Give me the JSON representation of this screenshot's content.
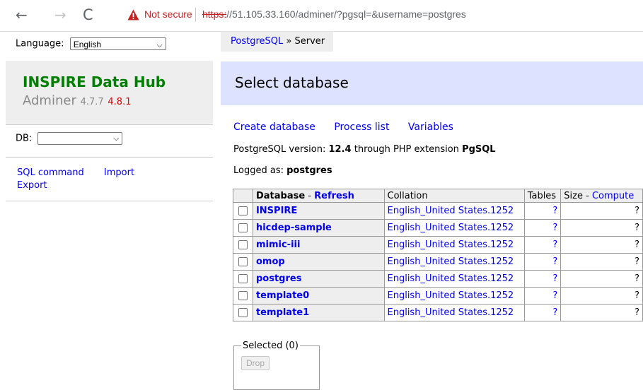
{
  "browser": {
    "back_glyph": "←",
    "forward_glyph": "→",
    "reload_glyph": "C",
    "security_label": "Not secure",
    "url_scheme": "https:",
    "url_rest": "//51.105.33.160/adminer/?pgsql=&username=postgres",
    "warning_color": "#c5221f"
  },
  "sidebar": {
    "language_label": "Language:",
    "language_value": "English",
    "brand_title": "INSPIRE Data Hub",
    "app_name": "Adminer",
    "version": "4.7.7",
    "new_version": "4.8.1",
    "db_label": "DB:",
    "db_value": "",
    "links": {
      "sql_command": "SQL command",
      "import": "Import",
      "export": "Export"
    }
  },
  "breadcrumb": {
    "driver": "PostgreSQL",
    "separator": "»",
    "current": "Server"
  },
  "main": {
    "title": "Select database",
    "actions": {
      "create_database": "Create database",
      "process_list": "Process list",
      "variables": "Variables"
    },
    "version_prefix": "PostgreSQL version:",
    "version_value": "12.4",
    "version_mid": "through PHP extension",
    "extension": "PgSQL",
    "logged_prefix": "Logged as:",
    "logged_user": "postgres"
  },
  "table": {
    "headers": {
      "database": "Database",
      "dash": "-",
      "refresh": "Refresh",
      "collation": "Collation",
      "tables": "Tables",
      "size": "Size",
      "compute": "Compute"
    },
    "rows": [
      {
        "name": "INSPIRE",
        "collation": "English_United States.1252",
        "tables": "?",
        "size": "?"
      },
      {
        "name": "hicdep-sample",
        "collation": "English_United States.1252",
        "tables": "?",
        "size": "?"
      },
      {
        "name": "mimic-iii",
        "collation": "English_United States.1252",
        "tables": "?",
        "size": "?"
      },
      {
        "name": "omop",
        "collation": "English_United States.1252",
        "tables": "?",
        "size": "?"
      },
      {
        "name": "postgres",
        "collation": "English_United States.1252",
        "tables": "?",
        "size": "?"
      },
      {
        "name": "template0",
        "collation": "English_United States.1252",
        "tables": "?",
        "size": "?"
      },
      {
        "name": "template1",
        "collation": "English_United States.1252",
        "tables": "?",
        "size": "?"
      }
    ]
  },
  "selection": {
    "legend": "Selected (0)",
    "drop_label": "Drop"
  }
}
